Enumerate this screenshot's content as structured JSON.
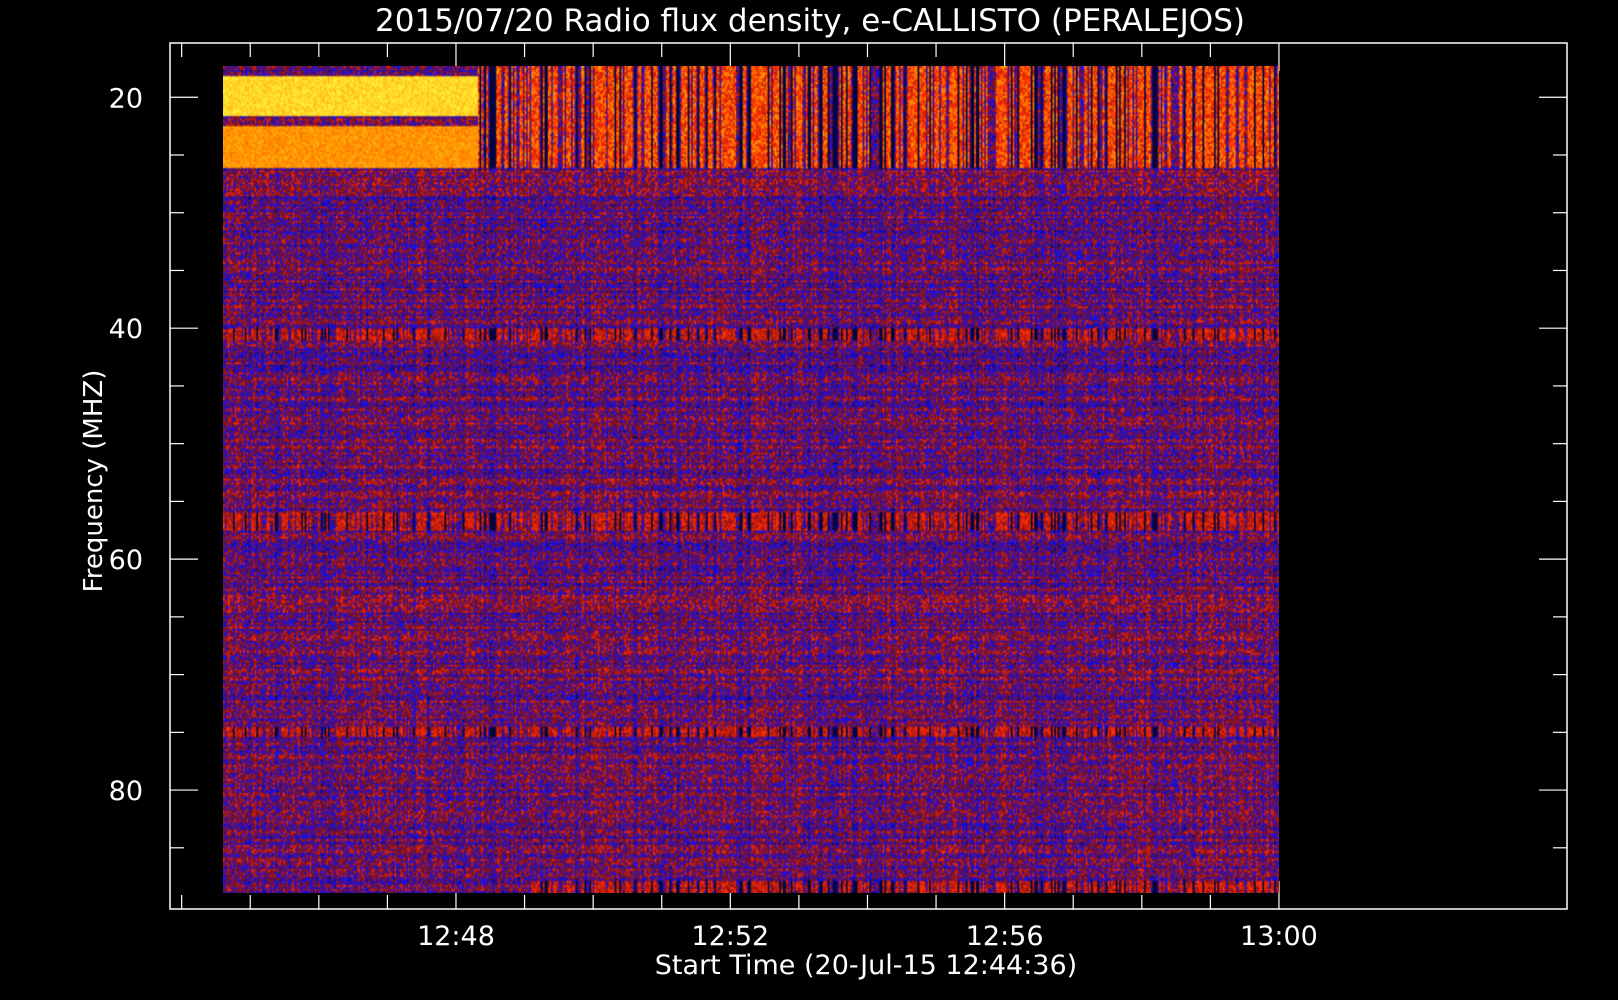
{
  "chart_data": {
    "type": "heatmap",
    "title": "2015/07/20  Radio flux density, e-CALLISTO (PERALEJOS)",
    "xlabel": "Start Time (20-Jul-15 12:44:36)",
    "ylabel": "Frequency (MHZ)",
    "x_ticks": [
      "12:48",
      "12:52",
      "12:56",
      "13:00"
    ],
    "x_tick_values_min": [
      3.4,
      7.4,
      11.4,
      15.4
    ],
    "x_range_min": [
      -0.77,
      19.6
    ],
    "data_range_min": [
      0.0,
      15.4
    ],
    "y_ticks": [
      "20",
      "40",
      "60",
      "80"
    ],
    "y_tick_values": [
      20,
      40,
      60,
      80
    ],
    "y_range": [
      15.3,
      90.3
    ],
    "data_freq_range": [
      17.3,
      88.9
    ],
    "y_reversed": true,
    "colormap": [
      "#000000",
      "#1010ff",
      "#8a1010",
      "#ff2000",
      "#ff9a00",
      "#ffff40"
    ],
    "features": [
      {
        "band_mhz": [
          18.0,
          21.5
        ],
        "time_min": [
          0.0,
          3.7
        ],
        "level": "saturated",
        "color": "#ffff40"
      },
      {
        "band_mhz": [
          22.5,
          26.0
        ],
        "time_min": [
          0.0,
          3.7
        ],
        "level": "high",
        "color": "#ff9a00"
      },
      {
        "band_mhz": [
          17.3,
          26.0
        ],
        "time_min": [
          3.7,
          15.4
        ],
        "level": "intermittent",
        "color": "#ff2000"
      },
      {
        "band_mhz": [
          40.0,
          41.0
        ],
        "time_min": [
          0.0,
          15.4
        ],
        "level": "moderate",
        "color": "#ff2000"
      },
      {
        "band_mhz": [
          56.0,
          57.5
        ],
        "time_min": [
          0.0,
          15.4
        ],
        "level": "moderate",
        "color": "#ff2000"
      },
      {
        "band_mhz": [
          74.5,
          75.5
        ],
        "time_min": [
          0.0,
          15.4
        ],
        "level": "moderate",
        "color": "#ff2000"
      },
      {
        "band_mhz": [
          88.0,
          88.9
        ],
        "time_min": [
          4.5,
          15.4
        ],
        "level": "moderate",
        "color": "#ff2000"
      }
    ]
  }
}
